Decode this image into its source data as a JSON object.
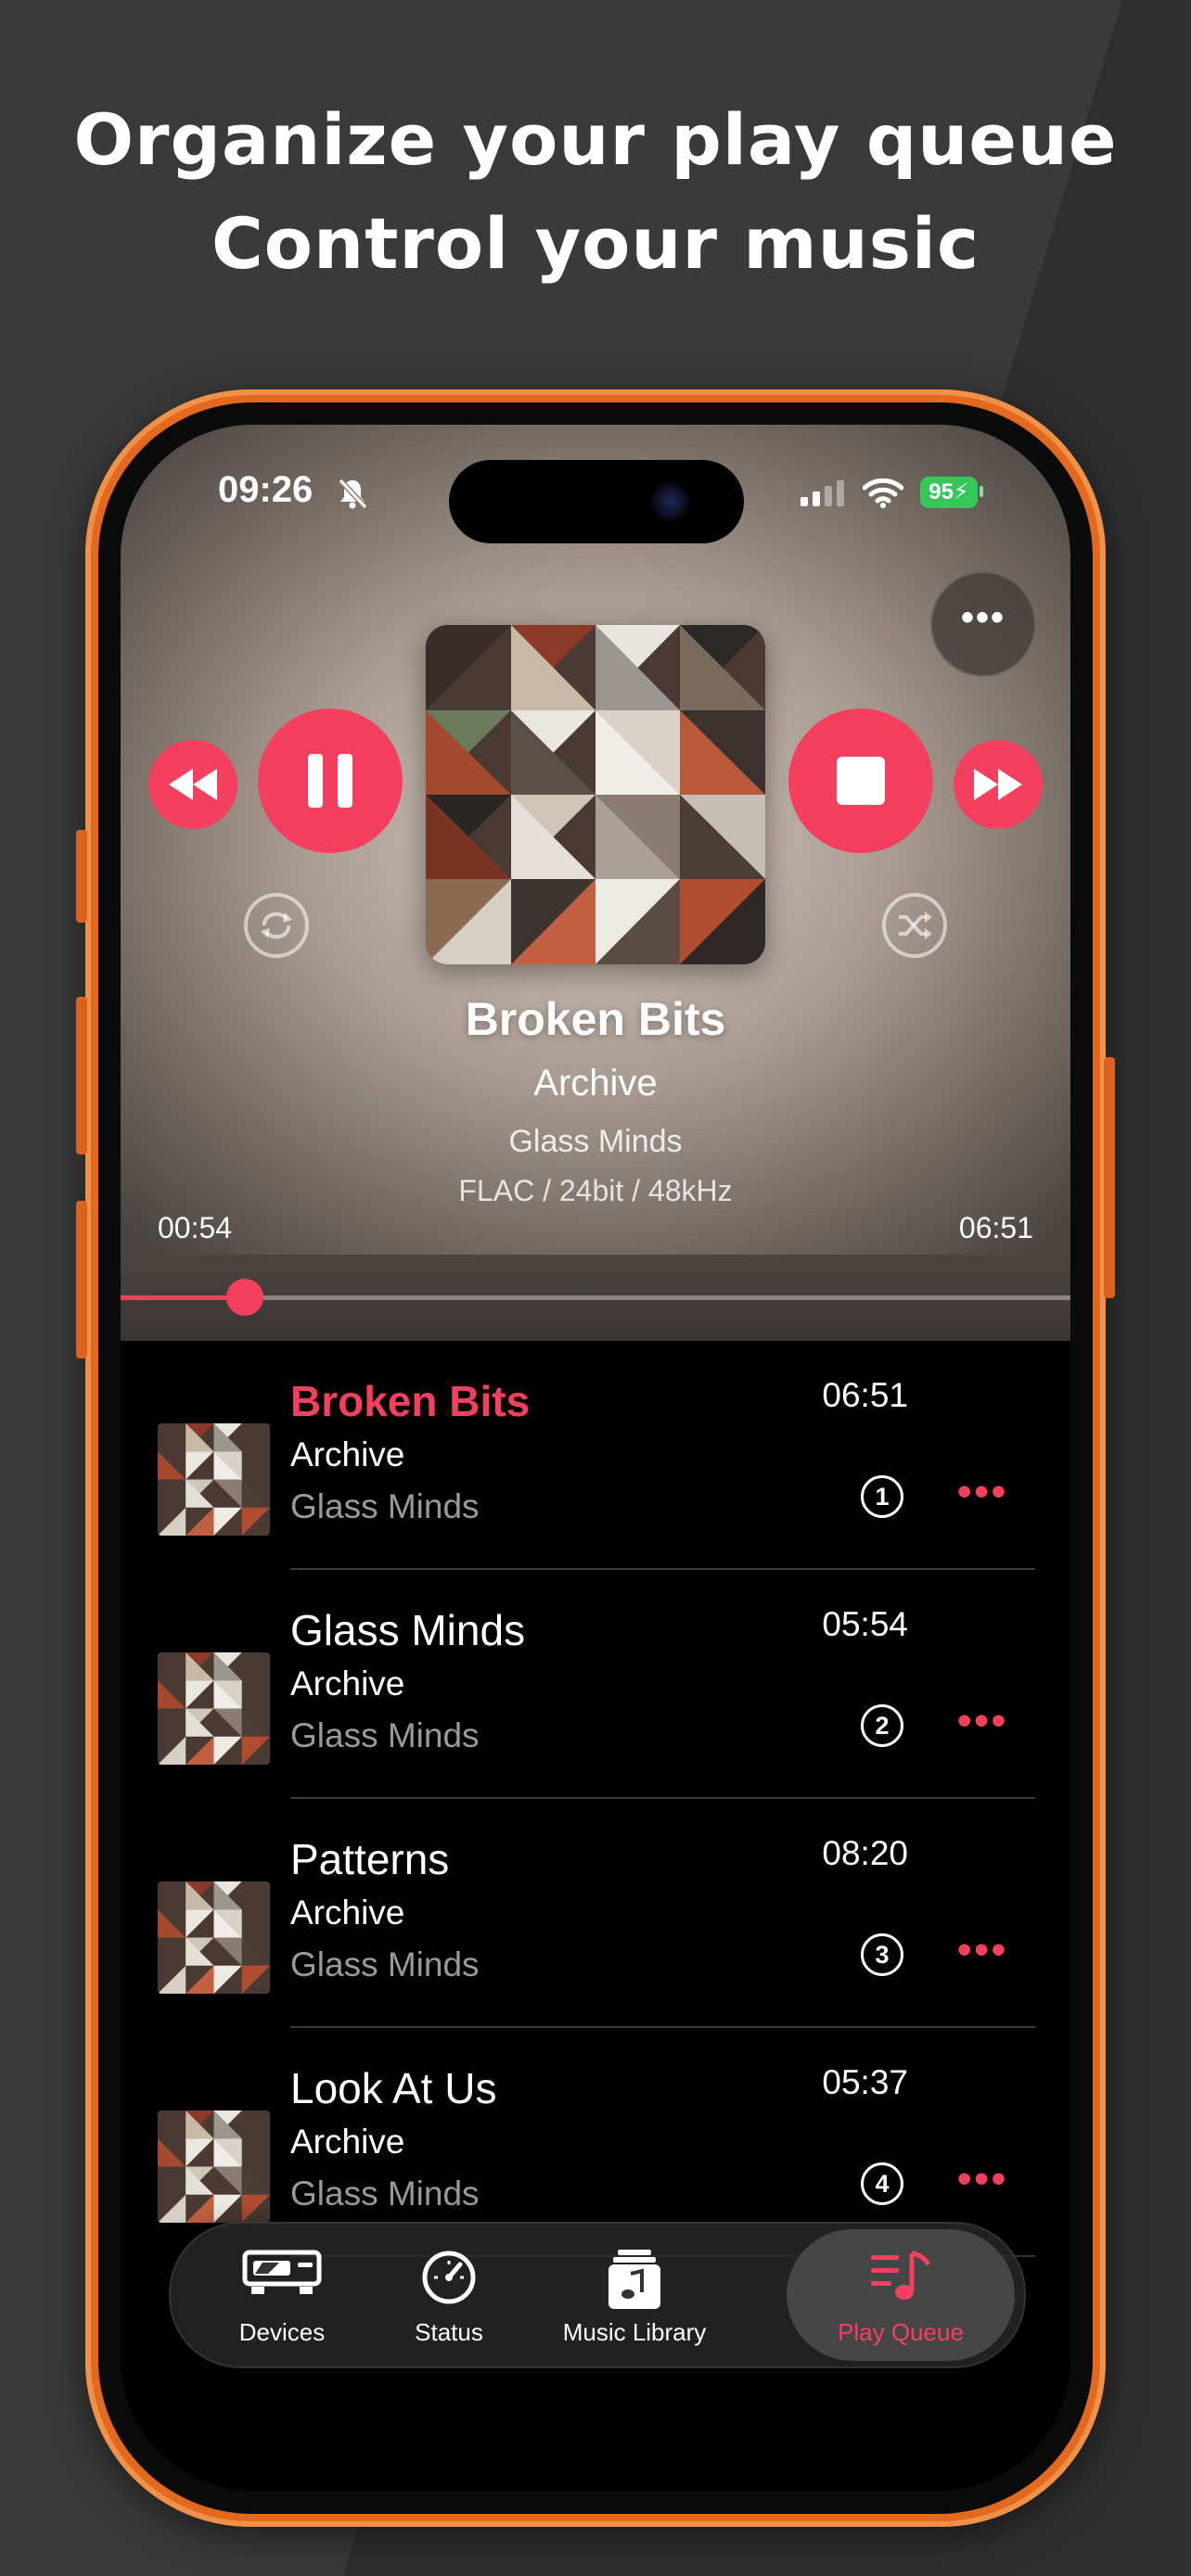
{
  "headline": {
    "line1": "Organize your play queue",
    "line2": "Control  your music"
  },
  "status_bar": {
    "time": "09:26",
    "battery": "95"
  },
  "now_playing": {
    "title": "Broken Bits",
    "album": "Archive",
    "artist": "Glass Minds",
    "format": "FLAC / 24bit / 48kHz",
    "elapsed": "00:54",
    "duration": "06:51",
    "progress_fraction": 0.131
  },
  "queue": [
    {
      "title": "Broken Bits",
      "album": "Archive",
      "artist": "Glass Minds",
      "duration": "06:51",
      "number": "1",
      "active": true
    },
    {
      "title": "Glass Minds",
      "album": "Archive",
      "artist": "Glass Minds",
      "duration": "05:54",
      "number": "2",
      "active": false
    },
    {
      "title": "Patterns",
      "album": "Archive",
      "artist": "Glass Minds",
      "duration": "08:20",
      "number": "3",
      "active": false
    },
    {
      "title": "Look At Us",
      "album": "Archive",
      "artist": "Glass Minds",
      "duration": "05:37",
      "number": "4",
      "active": false
    }
  ],
  "tabs": [
    {
      "label": "Devices",
      "icon": "devices-icon"
    },
    {
      "label": "Status",
      "icon": "gauge-icon"
    },
    {
      "label": "Music Library",
      "icon": "music-library-icon"
    },
    {
      "label": "Play Queue",
      "icon": "play-queue-icon"
    }
  ],
  "colors": {
    "accent": "#f43f5e",
    "frame": "#e2691d",
    "background": "#3a3a3a"
  }
}
